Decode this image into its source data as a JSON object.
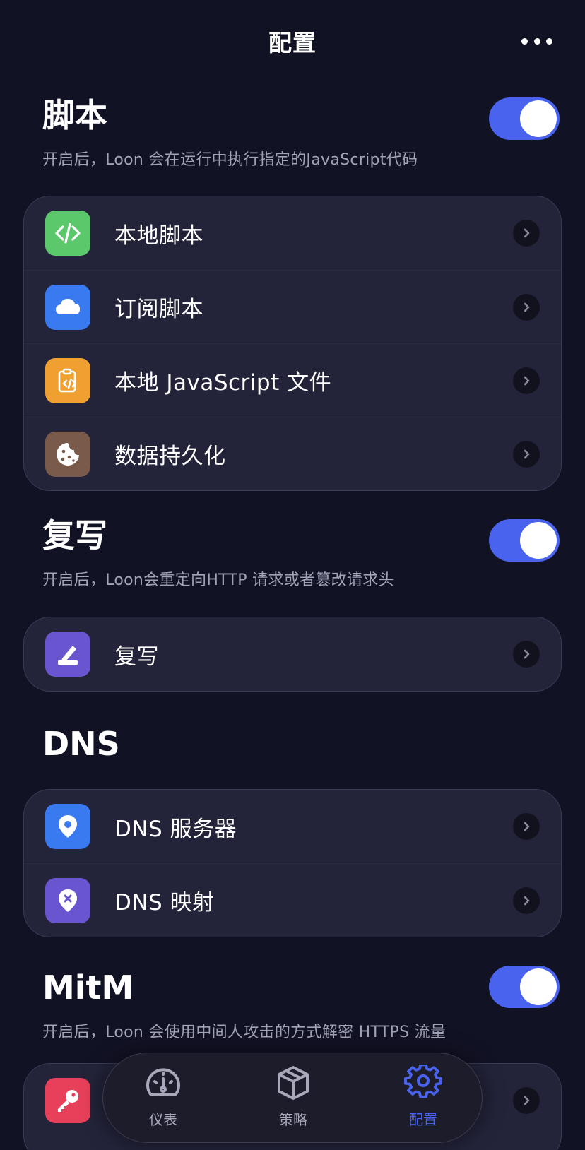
{
  "nav": {
    "title": "配置"
  },
  "sections": {
    "script": {
      "title": "脚本",
      "desc": "开启后，Loon 会在运行中执行指定的JavaScript代码",
      "toggle_on": true,
      "items": [
        {
          "label": "本地脚本",
          "icon": "code-icon",
          "color": "#5bc96b"
        },
        {
          "label": "订阅脚本",
          "icon": "cloud-icon",
          "color": "#3a7af0"
        },
        {
          "label": "本地 JavaScript 文件",
          "icon": "clipboard-code-icon",
          "color": "#f0a030"
        },
        {
          "label": "数据持久化",
          "icon": "cookie-icon",
          "color": "#7a5a4a"
        }
      ]
    },
    "rewrite": {
      "title": "复写",
      "desc": "开启后，Loon会重定向HTTP 请求或者篡改请求头",
      "toggle_on": true,
      "items": [
        {
          "label": "复写",
          "icon": "pen-icon",
          "color": "#6a55d0"
        }
      ]
    },
    "dns": {
      "title": "DNS",
      "items": [
        {
          "label": "DNS 服务器",
          "icon": "location-pin-icon",
          "color": "#3a7af0"
        },
        {
          "label": "DNS 映射",
          "icon": "pin-cross-icon",
          "color": "#6a55d0"
        }
      ]
    },
    "mitm": {
      "title": "MitM",
      "desc": "开启后，Loon 会使用中间人攻击的方式解密 HTTPS 流量",
      "toggle_on": true,
      "items": [
        {
          "label": "",
          "icon": "key-icon",
          "color": "#e8405a"
        }
      ]
    }
  },
  "tabbar": {
    "tabs": [
      {
        "label": "仪表",
        "icon": "dashboard-icon",
        "active": false
      },
      {
        "label": "策略",
        "icon": "cube-icon",
        "active": false
      },
      {
        "label": "配置",
        "icon": "gear-icon",
        "active": true
      }
    ],
    "accent": "#4a63ee"
  }
}
